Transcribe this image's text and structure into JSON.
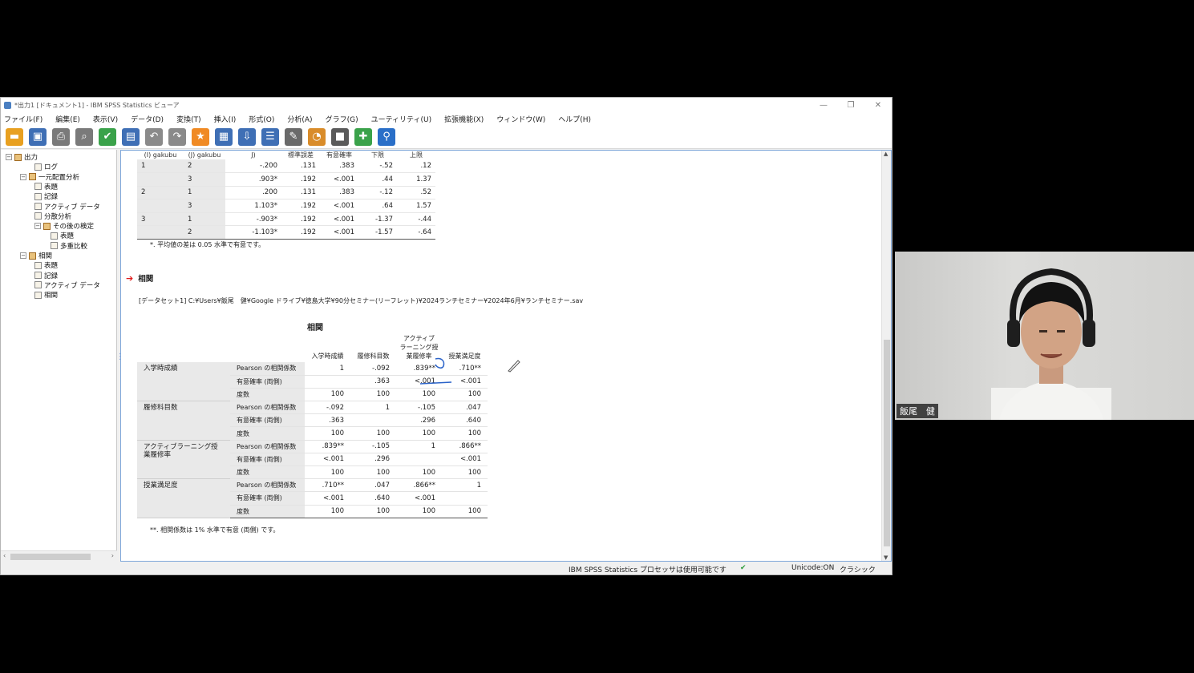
{
  "window": {
    "title": "*出力1 [ドキュメント1] - IBM SPSS Statistics ビューア",
    "controls": [
      "—",
      "❐",
      "✕"
    ]
  },
  "menu": [
    "ファイル(F)",
    "編集(E)",
    "表示(V)",
    "データ(D)",
    "変換(T)",
    "挿入(I)",
    "形式(O)",
    "分析(A)",
    "グラフ(G)",
    "ユーティリティ(U)",
    "拡張機能(X)",
    "ウィンドウ(W)",
    "ヘルプ(H)"
  ],
  "toolbar": [
    {
      "icon": "open-folder-icon",
      "color": "#e8a020"
    },
    {
      "icon": "save-icon",
      "color": "#3f6fb5"
    },
    {
      "icon": "print-icon",
      "color": "#7a7a7a"
    },
    {
      "icon": "print-preview-icon",
      "color": "#7a7a7a"
    },
    {
      "icon": "export-icon",
      "color": "#3aa24a"
    },
    {
      "icon": "recall-dialog-icon",
      "color": "#3f6fb5"
    },
    {
      "icon": "undo-icon",
      "color": "#8a8a8a"
    },
    {
      "icon": "redo-icon",
      "color": "#8a8a8a"
    },
    {
      "icon": "goto-data-icon",
      "color": "#f08a24"
    },
    {
      "icon": "goto-case-icon",
      "color": "#3f6fb5"
    },
    {
      "icon": "goto-variable-icon",
      "color": "#3f6fb5"
    },
    {
      "icon": "variables-icon",
      "color": "#3f6fb5"
    },
    {
      "icon": "edit-icon",
      "color": "#6a6a6a"
    },
    {
      "icon": "chart-builder-icon",
      "color": "#d98c2a"
    },
    {
      "icon": "select-output-icon",
      "color": "#5a5a5a"
    },
    {
      "icon": "insert-icon",
      "color": "#3aa24a"
    },
    {
      "icon": "search-icon",
      "color": "#2a6fc8"
    }
  ],
  "tree": [
    {
      "label": "出力",
      "level": 0,
      "expand": "−",
      "book": true
    },
    {
      "label": "ログ",
      "level": 2,
      "book": false
    },
    {
      "label": "一元配置分析",
      "level": 1,
      "expand": "−",
      "book": true
    },
    {
      "label": "表題",
      "level": 2,
      "book": false
    },
    {
      "label": "記録",
      "level": 2,
      "book": false
    },
    {
      "label": "アクティブ データ",
      "level": 2,
      "book": false
    },
    {
      "label": "分散分析",
      "level": 2,
      "book": false
    },
    {
      "label": "その後の検定",
      "level": 2,
      "expand": "−",
      "book": true
    },
    {
      "label": "表題",
      "level": 3,
      "book": false
    },
    {
      "label": "多重比較",
      "level": 3,
      "book": false
    },
    {
      "label": "相関",
      "level": 1,
      "expand": "−",
      "book": true
    },
    {
      "label": "表題",
      "level": 2,
      "book": false
    },
    {
      "label": "記録",
      "level": 2,
      "book": false
    },
    {
      "label": "アクティブ データ",
      "level": 2,
      "book": false
    },
    {
      "label": "相関",
      "level": 2,
      "book": false
    }
  ],
  "multcomp": {
    "headers": [
      "(I) gakubu",
      "(J) gakubu",
      "J)",
      "標準誤差",
      "有意確率",
      "下限",
      "上限"
    ],
    "rows": [
      [
        "1",
        "2",
        "-.200",
        ".131",
        ".383",
        "-.52",
        ".12"
      ],
      [
        "",
        "3",
        ".903*",
        ".192",
        "<.001",
        ".44",
        "1.37"
      ],
      [
        "2",
        "1",
        ".200",
        ".131",
        ".383",
        "-.12",
        ".52"
      ],
      [
        "",
        "3",
        "1.103*",
        ".192",
        "<.001",
        ".64",
        "1.57"
      ],
      [
        "3",
        "1",
        "-.903*",
        ".192",
        "<.001",
        "-1.37",
        "-.44"
      ],
      [
        "",
        "2",
        "-1.103*",
        ".192",
        "<.001",
        "-1.57",
        "-.64"
      ]
    ],
    "footnote": "*. 平均値の差は 0.05 水準で有意です。"
  },
  "section_title": "相関",
  "dataset": "[データセット1] C:¥Users¥飯尾　健¥Google ドライブ¥徳島大学¥90分セミナー(リーフレット)¥2024ランチセミナー¥2024年6月¥ランチセミナー.sav",
  "corr": {
    "title": "相関",
    "col_headers": [
      "入学時成績",
      "履修科目数",
      "アクティブラーニング授業履修率",
      "授業満足度"
    ],
    "col_header_lines": [
      [
        "入学時成績"
      ],
      [
        "履修科目数"
      ],
      [
        "アクティブ",
        "ラーニング授",
        "業履修率"
      ],
      [
        "授業満足度"
      ]
    ],
    "stat_labels": [
      "Pearson の相関係数",
      "有意確率 (両側)",
      "度数"
    ],
    "blocks": [
      {
        "label": "入学時成績",
        "rows": [
          [
            "1",
            "-.092",
            ".839**",
            ".710**"
          ],
          [
            "",
            ".363",
            "<.001",
            "<.001"
          ],
          [
            "100",
            "100",
            "100",
            "100"
          ]
        ]
      },
      {
        "label": "履修科目数",
        "rows": [
          [
            "-.092",
            "1",
            "-.105",
            ".047"
          ],
          [
            ".363",
            "",
            ".296",
            ".640"
          ],
          [
            "100",
            "100",
            "100",
            "100"
          ]
        ]
      },
      {
        "label": "アクティブラーニング授業履修率",
        "rows": [
          [
            ".839**",
            "-.105",
            "1",
            ".866**"
          ],
          [
            "<.001",
            ".296",
            "",
            "<.001"
          ],
          [
            "100",
            "100",
            "100",
            "100"
          ]
        ]
      },
      {
        "label": "授業満足度",
        "rows": [
          [
            ".710**",
            ".047",
            ".866**",
            "1"
          ],
          [
            "<.001",
            ".640",
            "<.001",
            ""
          ],
          [
            "100",
            "100",
            "100",
            "100"
          ]
        ]
      }
    ],
    "footnote": "**. 相関係数は 1% 水準で有意 (両側) です。"
  },
  "status": {
    "processor": "IBM SPSS Statistics プロセッサは使用可能です",
    "unicode": "Unicode:ON",
    "mode": "クラシック"
  },
  "video": {
    "name": "飯尾　健"
  }
}
